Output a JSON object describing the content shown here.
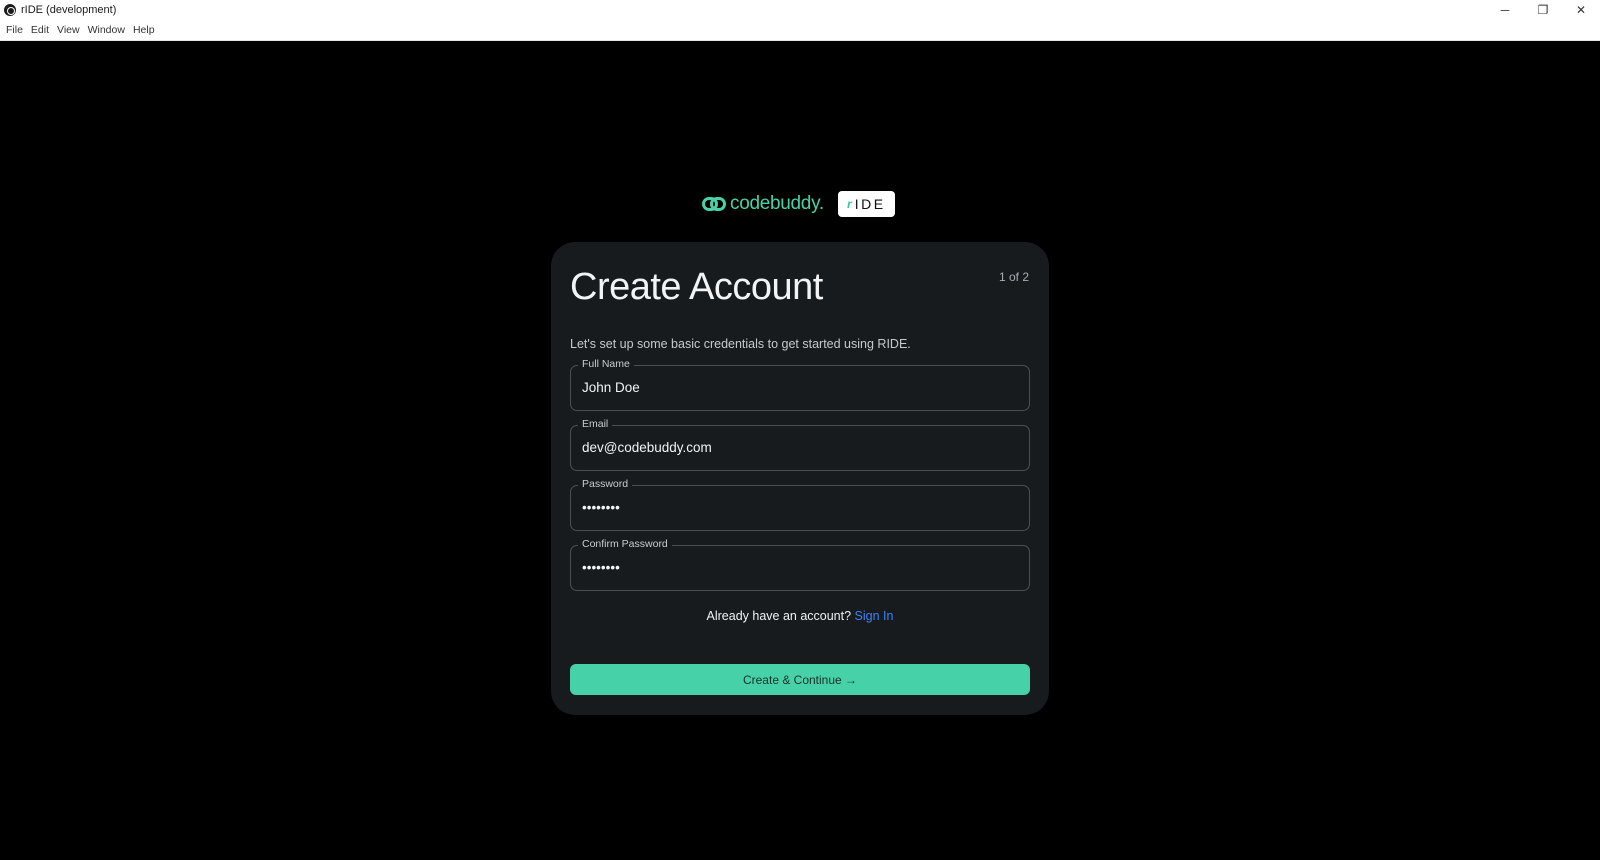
{
  "window": {
    "title": "rIDE (development)",
    "controls": {
      "minimize": "─",
      "restore": "❐",
      "close": "✕"
    }
  },
  "menubar": {
    "items": [
      "File",
      "Edit",
      "View",
      "Window",
      "Help"
    ]
  },
  "brand": {
    "name": "codebuddy.",
    "product_prefix": "r",
    "product": "IDE",
    "accent_color": "#47d1a8"
  },
  "card": {
    "title": "Create Account",
    "step": "1 of 2",
    "subtitle": "Let's set up some basic credentials to get started using RIDE.",
    "fields": [
      {
        "label": "Full Name",
        "value": "John Doe"
      },
      {
        "label": "Email",
        "value": "dev@codebuddy.com"
      },
      {
        "label": "Password",
        "value": "••••••••"
      },
      {
        "label": "Confirm Password",
        "value": "••••••••"
      }
    ],
    "signin_prompt": "Already have an account?",
    "signin_link": "Sign In",
    "cta_label": "Create & Continue →"
  }
}
